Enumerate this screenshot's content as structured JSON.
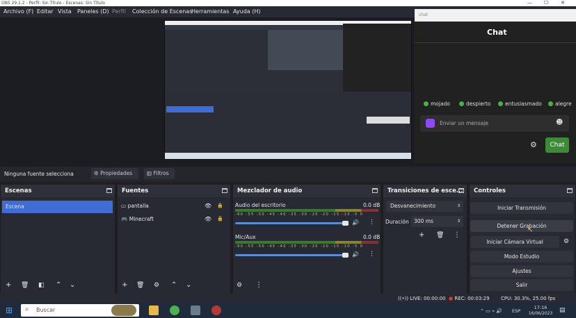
{
  "window": {
    "title": "OBS 29.1.2 - Perfil: Sin Título - Escenas: Sin Título"
  },
  "menu": [
    "Archivo (F)",
    "Editar",
    "Vista",
    "Paneles (D)",
    "Perfil",
    "Colección de Escenas",
    "Herramientas",
    "Ayuda (H)"
  ],
  "chat": {
    "url_text": "chat",
    "title": "Chat",
    "emotes": [
      "mojado",
      "despierto",
      "entusiasmado",
      "alegre"
    ],
    "input_placeholder": "Enviar un mensaje",
    "send_label": "Chat"
  },
  "context": {
    "no_source_text": "Ninguna fuente seleccionada",
    "properties_label": "Propiedades",
    "filters_label": "Filtros"
  },
  "scenes": {
    "title": "Escenas",
    "items": [
      "Escena"
    ]
  },
  "sources": {
    "title": "Fuentes",
    "items": [
      "pantalla",
      "Minecraft"
    ]
  },
  "mixer": {
    "title": "Mezclador de audio",
    "tracks": [
      {
        "name": "Audio del escritorio",
        "db": "0.0 dB"
      },
      {
        "name": "Mic/Aux",
        "db": "0.0 dB"
      }
    ],
    "ticks": "-60 -55 -50 -45 -40 -35 -30 -25 -20 -15 -10 -5 0"
  },
  "transitions": {
    "title": "Transiciones de esce...",
    "selected": "Desvanecimiento",
    "duration_label": "Duración",
    "duration_value": "300 ms"
  },
  "controls": {
    "title": "Controles",
    "buttons": [
      "Iniciar Transmisión",
      "Detener Grabación",
      "Iniciar Cámara Virtual",
      "Modo Estudio",
      "Ajustes",
      "Salir"
    ]
  },
  "status": {
    "live": "LIVE: 00:00:00",
    "rec": "REC: 00:03:29",
    "cpu": "CPU: 30.3%, 25.00 fps"
  },
  "taskbar": {
    "search_placeholder": "Buscar",
    "lang": "ESP",
    "time": "17:16",
    "date": "16/06/2023"
  },
  "colors": {
    "accent_blue": "#3f6dd3",
    "chat_send_green": "#3d8b37",
    "rec_red": "#e53935"
  }
}
